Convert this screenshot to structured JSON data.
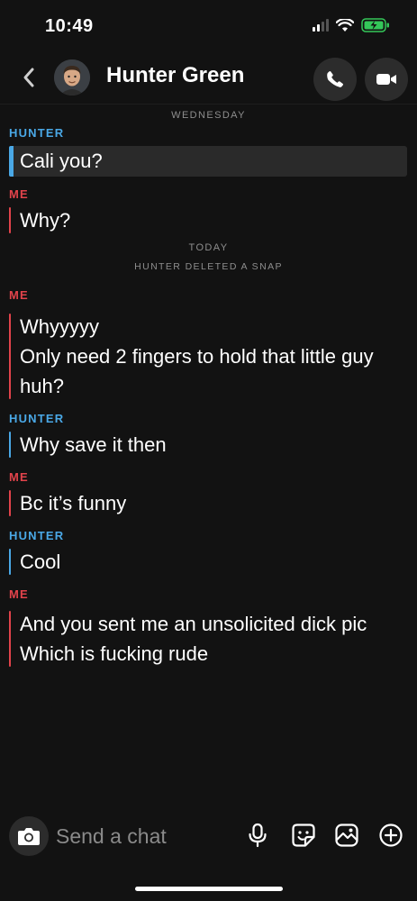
{
  "status_bar": {
    "time": "10:49",
    "signal_icon": "cellular-signal-icon",
    "wifi_icon": "wifi-icon",
    "battery_icon": "battery-charging-icon",
    "battery_color": "#34c759"
  },
  "header": {
    "back_icon": "chevron-left-icon",
    "contact_name": "Hunter Green",
    "call_icon": "phone-icon",
    "video_icon": "video-camera-icon"
  },
  "conversation": {
    "day_wednesday": "WEDNESDAY",
    "hunter_label_1": "HUNTER",
    "msg_cali": "Cali you?",
    "me_label_1": "ME",
    "msg_why": "Why?",
    "day_today": "TODAY",
    "deleted_notice": "HUNTER DELETED A SNAP",
    "me_label_2": "ME",
    "msg_whyyyyy": "Whyyyyy",
    "msg_fingers": "Only need 2 fingers to hold that little guy huh?",
    "hunter_label_2": "HUNTER",
    "msg_save": "Why save it then",
    "me_label_3": "ME",
    "msg_funny": "Bc it’s funny",
    "hunter_label_3": "HUNTER",
    "msg_cool": "Cool",
    "me_label_4": "ME",
    "msg_unsolicited": "And you sent me an unsolicited dick pic",
    "msg_rude": "Which is fucking rude"
  },
  "colors": {
    "hunter": "#4aa8e6",
    "me": "#e2434b",
    "background": "#121212"
  },
  "composer": {
    "camera_icon": "camera-icon",
    "placeholder": "Send a chat",
    "mic_icon": "microphone-icon",
    "sticker_icon": "sticker-icon",
    "memories_icon": "memories-icon",
    "plus_icon": "plus-circle-icon"
  }
}
